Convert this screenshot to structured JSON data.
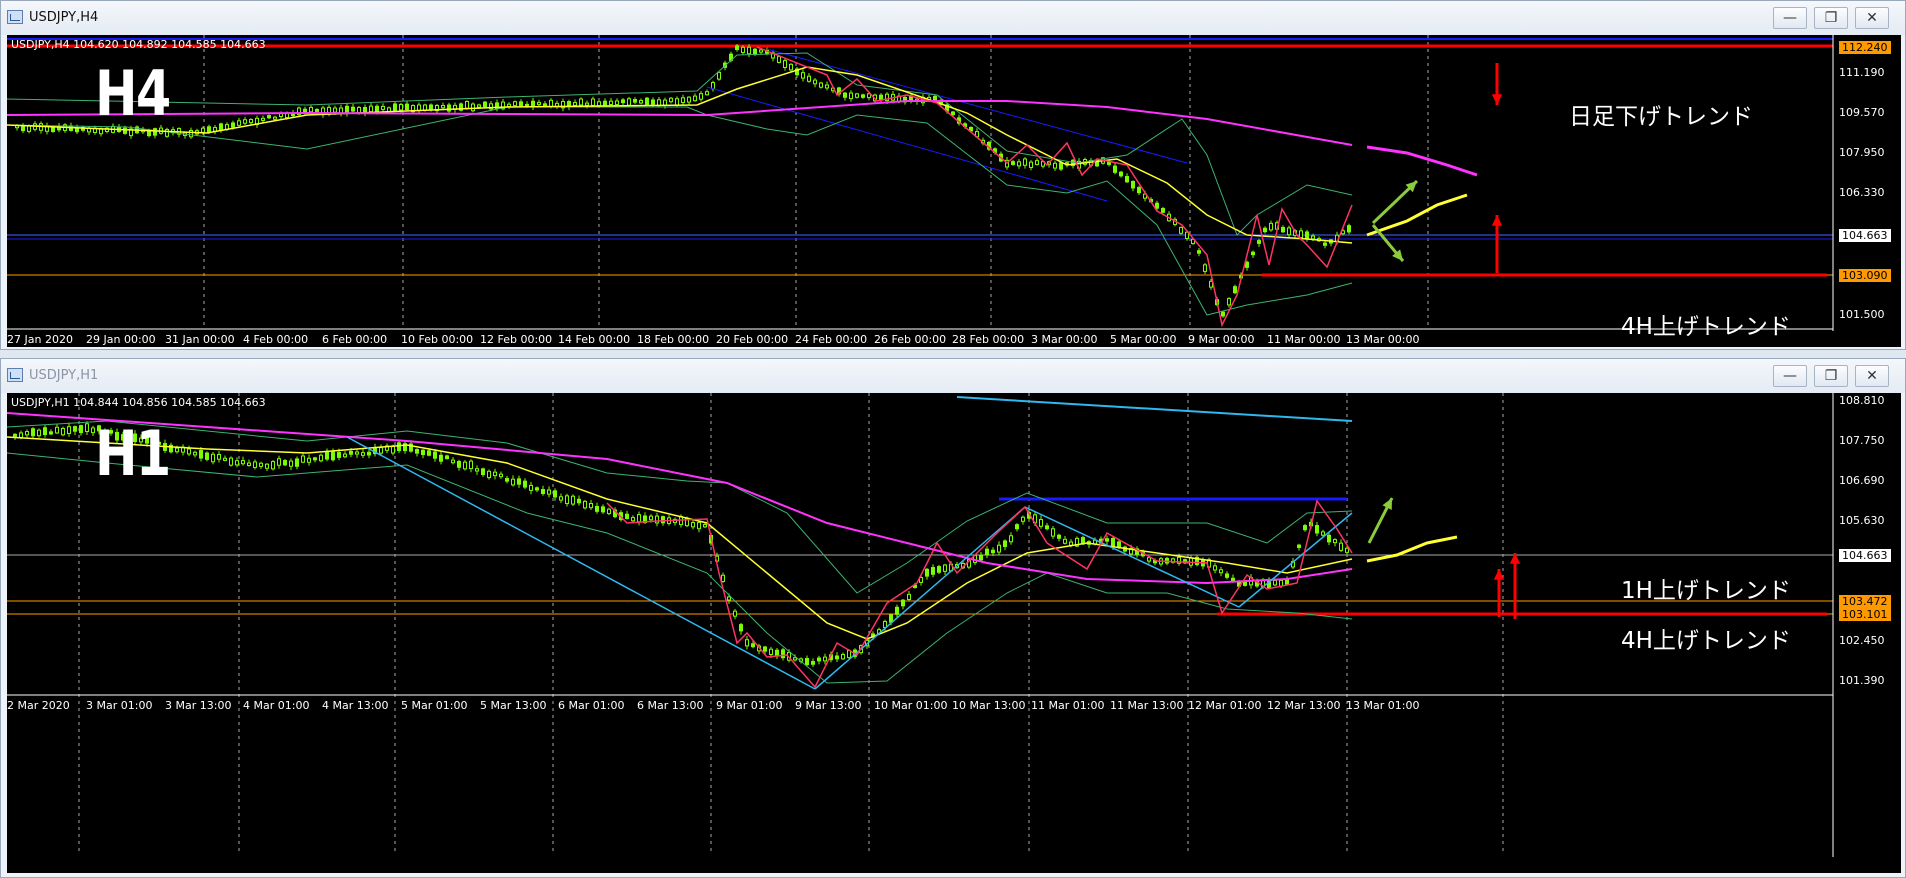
{
  "windows": [
    {
      "title": "USDJPY,H4",
      "info": "USDJPY,H4  104.620 104.892 104.585 104.663",
      "big_label": "H4",
      "price_labels": [
        "111.190",
        "109.570",
        "107.950",
        "106.330",
        "101.500"
      ],
      "price_tags": [
        {
          "text": "112.240",
          "bg": "#ff9900",
          "fg": "#000"
        },
        {
          "text": "104.663",
          "bg": "#ffffff",
          "fg": "#000"
        },
        {
          "text": "103.090",
          "bg": "#ff9900",
          "fg": "#000"
        }
      ],
      "time_labels": [
        "27 Jan 2020",
        "29 Jan 00:00",
        "31 Jan 00:00",
        "4 Feb 00:00",
        "6 Feb 00:00",
        "10 Feb 00:00",
        "12 Feb 00:00",
        "14 Feb 00:00",
        "18 Feb 00:00",
        "20 Feb 00:00",
        "24 Feb 00:00",
        "26 Feb 00:00",
        "28 Feb 00:00",
        "3 Mar 00:00",
        "5 Mar 00:00",
        "9 Mar 00:00",
        "11 Mar 00:00",
        "13 Mar 00:00"
      ],
      "notes": [
        "日足下げトレンド",
        "4H上げトレンド"
      ]
    },
    {
      "title": "USDJPY,H1",
      "info": "USDJPY,H1  104.844 104.856 104.585 104.663",
      "big_label": "H1",
      "price_labels": [
        "108.810",
        "107.750",
        "106.690",
        "105.630",
        "102.450",
        "101.390"
      ],
      "price_tags": [
        {
          "text": "104.663",
          "bg": "#ffffff",
          "fg": "#000"
        },
        {
          "text": "103.472",
          "bg": "#ff9900",
          "fg": "#000"
        },
        {
          "text": "103.101",
          "bg": "#ff9900",
          "fg": "#000"
        }
      ],
      "time_labels": [
        "2 Mar 2020",
        "3 Mar 01:00",
        "3 Mar 13:00",
        "4 Mar 01:00",
        "4 Mar 13:00",
        "5 Mar 01:00",
        "5 Mar 13:00",
        "6 Mar 01:00",
        "6 Mar 13:00",
        "9 Mar 01:00",
        "9 Mar 13:00",
        "10 Mar 01:00",
        "10 Mar 13:00",
        "11 Mar 01:00",
        "11 Mar 13:00",
        "12 Mar 01:00",
        "12 Mar 13:00",
        "13 Mar 01:00"
      ],
      "notes": [
        "1H上げトレンド",
        "4H上げトレンド"
      ]
    }
  ],
  "controls": {
    "minimize": "—",
    "restore": "❐",
    "close": "✕"
  },
  "colors": {
    "background": "#000000",
    "candle": "#7cfc00",
    "bb": "#3cb371",
    "ma_yellow": "#ffff33",
    "ma_magenta": "#ff33ff",
    "zigzag": "#ff3366",
    "trend_blue": "#1a1aff",
    "trend_cyan": "#2fb8f0",
    "arrow_red": "#ff0000",
    "arrow_green": "#8ccc3c"
  }
}
